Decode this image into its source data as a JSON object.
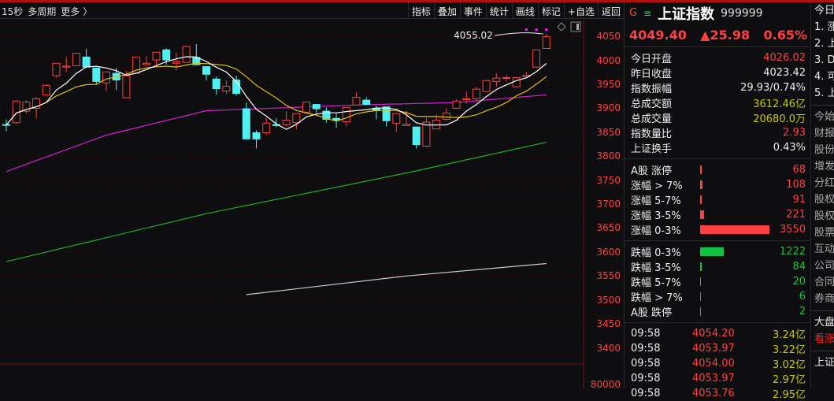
{
  "toolbar": {
    "period": "15秒",
    "multi": "多周期",
    "more": "更多 〉",
    "buttons": [
      "指标",
      "叠加",
      "事件",
      "统计",
      "画线",
      "标记",
      "+自选",
      "返回"
    ]
  },
  "chart_data": {
    "type": "candlestick",
    "ylim": [
      3340,
      4080
    ],
    "yticks": [
      4050,
      4000,
      3950,
      3900,
      3850,
      3800,
      3750,
      3700,
      3650,
      3600,
      3550,
      3500,
      3450,
      3400
    ],
    "volume_tick": "80000",
    "annotation": "4055.02",
    "ohlc": [
      [
        3866,
        3877,
        3852,
        3865
      ],
      [
        3870,
        3917,
        3867,
        3915
      ],
      [
        3894,
        3917,
        3889,
        3913
      ],
      [
        3900,
        3923,
        3879,
        3920
      ],
      [
        3928,
        3950,
        3928,
        3948
      ],
      [
        3968,
        3994,
        3964,
        3994
      ],
      [
        3986,
        4007,
        3976,
        3988
      ],
      [
        3989,
        4015,
        3989,
        4015
      ],
      [
        4007,
        4024,
        3986,
        3986
      ],
      [
        3984,
        3984,
        3951,
        3956
      ],
      [
        3953,
        3976,
        3936,
        3976
      ],
      [
        3973,
        3984,
        3938,
        3959
      ],
      [
        3922,
        3978,
        3922,
        3968
      ],
      [
        3973,
        4007,
        3973,
        4007
      ],
      [
        3991,
        4009,
        3991,
        3994
      ],
      [
        4001,
        4017,
        3989,
        4017
      ],
      [
        4022,
        4025,
        3991,
        4001
      ],
      [
        3994,
        4017,
        3979,
        3997
      ],
      [
        3996,
        4029,
        3996,
        4029
      ],
      [
        4006,
        4034,
        3991,
        3991
      ],
      [
        3987,
        3987,
        3958,
        3971
      ],
      [
        3961,
        3966,
        3928,
        3941
      ],
      [
        3936,
        3958,
        3930,
        3946
      ],
      [
        3959,
        3968,
        3927,
        3931
      ],
      [
        3899,
        3912,
        3836,
        3836
      ],
      [
        3849,
        3854,
        3816,
        3836
      ],
      [
        3849,
        3880,
        3844,
        3869
      ],
      [
        3866,
        3879,
        3861,
        3864
      ],
      [
        3866,
        3894,
        3862,
        3875
      ],
      [
        3870,
        3889,
        3856,
        3889
      ],
      [
        3892,
        3913,
        3890,
        3913
      ],
      [
        3908,
        3908,
        3890,
        3899
      ],
      [
        3894,
        3902,
        3870,
        3877
      ],
      [
        3879,
        3889,
        3859,
        3875
      ],
      [
        3872,
        3902,
        3862,
        3902
      ],
      [
        3907,
        3933,
        3907,
        3923
      ],
      [
        3917,
        3923,
        3908,
        3908
      ],
      [
        3900,
        3905,
        3877,
        3895
      ],
      [
        3903,
        3903,
        3862,
        3874
      ],
      [
        3869,
        3889,
        3851,
        3889
      ],
      [
        3864,
        3895,
        3864,
        3867
      ],
      [
        3861,
        3862,
        3816,
        3824
      ],
      [
        3821,
        3880,
        3819,
        3871
      ],
      [
        3857,
        3887,
        3857,
        3875
      ],
      [
        3877,
        3900,
        3874,
        3890
      ],
      [
        3900,
        3918,
        3900,
        3915
      ],
      [
        3918,
        3935,
        3910,
        3920
      ],
      [
        3920,
        3945,
        3913,
        3940
      ],
      [
        3935,
        3958,
        3935,
        3958
      ],
      [
        3956,
        3973,
        3945,
        3963
      ],
      [
        3963,
        3969,
        3956,
        3964
      ],
      [
        3945,
        3964,
        3945,
        3964
      ],
      [
        3966,
        3976,
        3966,
        3969
      ],
      [
        3986,
        4022,
        3986,
        4022
      ],
      [
        4025,
        4055.02,
        4025,
        4049.4
      ]
    ],
    "ma_long": {
      "color": "#d020d0",
      "points": [
        [
          0,
          3768
        ],
        [
          10,
          3844
        ],
        [
          20,
          3895
        ],
        [
          24,
          3898
        ],
        [
          35,
          3907
        ],
        [
          45,
          3912
        ],
        [
          54,
          3928
        ]
      ]
    },
    "ma_green": {
      "color": "#20b020",
      "points": [
        [
          0,
          3580
        ],
        [
          20,
          3680
        ],
        [
          40,
          3765
        ],
        [
          54,
          3829
        ]
      ]
    },
    "ma_white_long": {
      "color": "#cccccc",
      "points": [
        [
          24,
          3511
        ],
        [
          40,
          3550
        ],
        [
          54,
          3576
        ]
      ]
    },
    "colors": {
      "up": "#ff4040",
      "down": "#50f0f0",
      "ma5": "#ffffff",
      "ma10": "#e0c000"
    }
  },
  "quote": {
    "g": "G",
    "menu": "≡",
    "name": "上证指数",
    "code": "999999",
    "price": "4049.40",
    "change": "▲25.98",
    "pct": "0.65%"
  },
  "stats": [
    {
      "label": "今日开盘",
      "value": "4026.02",
      "c": "red"
    },
    {
      "label": "昨日收盘",
      "value": "4023.42",
      "c": "wht"
    },
    {
      "label": "指数振幅",
      "value": "29.93/0.74%",
      "c": "wht"
    },
    {
      "label": "总成交额",
      "value": "3612.46亿",
      "c": "yel"
    },
    {
      "label": "总成交量",
      "value": "20680.0万",
      "c": "yel"
    },
    {
      "label": "指数量比",
      "value": "2.93",
      "c": "red"
    },
    {
      "label": "上证换手",
      "value": "0.43%",
      "c": "wht"
    }
  ],
  "up": [
    {
      "label": "A股 涨停",
      "value": "68"
    },
    {
      "label": "涨幅 > 7%",
      "value": "108"
    },
    {
      "label": "涨幅 5-7%",
      "value": "91"
    },
    {
      "label": "涨幅 3-5%",
      "value": "221"
    },
    {
      "label": "涨幅 0-3%",
      "value": "3550"
    }
  ],
  "down": [
    {
      "label": "跌幅 0-3%",
      "value": "1222"
    },
    {
      "label": "跌幅 3-5%",
      "value": "84"
    },
    {
      "label": "跌幅 5-7%",
      "value": "20"
    },
    {
      "label": "跌幅 > 7%",
      "value": "6"
    },
    {
      "label": "A股 跌停",
      "value": "2"
    }
  ],
  "ticks": [
    {
      "time": "09:58",
      "price": "4054.20",
      "amount": "3.24亿"
    },
    {
      "time": "09:58",
      "price": "4053.97",
      "amount": "3.22亿"
    },
    {
      "time": "09:58",
      "price": "4054.00",
      "amount": "3.02亿"
    },
    {
      "time": "09:58",
      "price": "4053.97",
      "amount": "2.97亿"
    },
    {
      "time": "09:58",
      "price": "4053.76",
      "amount": "2.95亿"
    }
  ],
  "col3": [
    "今日",
    "1. 涨",
    "2. 上",
    "3. D",
    "4. 可",
    "5. 上",
    "今始",
    "财报",
    "股份",
    "增发",
    "分红",
    "股权",
    "股权",
    "股票",
    "互动",
    "公司",
    "合同",
    "券商",
    "大盘",
    "看涨",
    "上证"
  ]
}
